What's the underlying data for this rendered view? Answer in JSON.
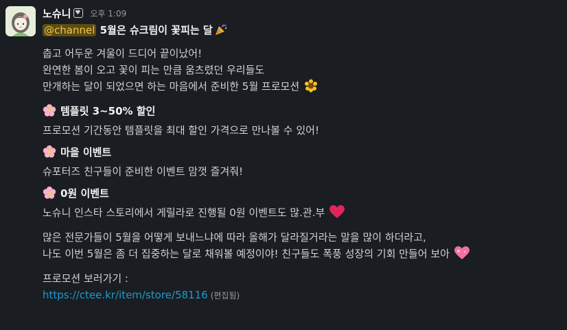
{
  "sender": {
    "name": "노슈니",
    "time": "오후 1:09"
  },
  "message": {
    "mention": "@channel",
    "headline": "5월은 슈크림이 꽃피는 달",
    "intro": [
      "춥고 어두운 겨울이 드디어 끝이났어!",
      "완연한 봄이 오고 꽃이 피는 만큼 움츠렸던 우리들도",
      "만개하는 달이 되었으면 하는 마음에서 준비한 5월 프로모션"
    ],
    "sections": [
      {
        "title": "템플릿 3~50% 할인",
        "body": "프로모션 기간동안 템플릿을 최대 할인 가격으로 만나볼 수 있어!"
      },
      {
        "title": "마을 이벤트",
        "body": "슈포터즈 친구들이 준비한 이벤트 맘껏 즐겨줘!"
      },
      {
        "title": "0원 이벤트",
        "body": "노슈니 인스타 스토리에서 게릴라로 진행될 0원 이벤트도 많.관.부"
      }
    ],
    "outro": [
      "많은 전문가들이 5월을 어떻게 보내느냐에 따라 올해가 달라질거라는 말을 많이 하더라고,",
      "나도 이번 5월은 좀 더 집중하는 달로 채워볼 예정이야! 친구들도 폭풍 성장의 기회 만들어 보아"
    ],
    "cta_label": "프로모션 보러가기 :",
    "link": "https://ctee.kr/item/store/58116",
    "edited": "(편집됨)"
  },
  "icons": {
    "headline": "party-popper-icon",
    "intro_end": "sunflower-icon",
    "section": "cherry-blossom-icon",
    "zero_event_end": "red-heart-icon",
    "outro_end": "sparkling-heart-icon"
  },
  "colors": {
    "background": "#1a1d21",
    "text": "#d1d2d3",
    "mention_bg": "#5b4c15",
    "mention_text": "#f2c744",
    "link": "#1d9bd1"
  }
}
